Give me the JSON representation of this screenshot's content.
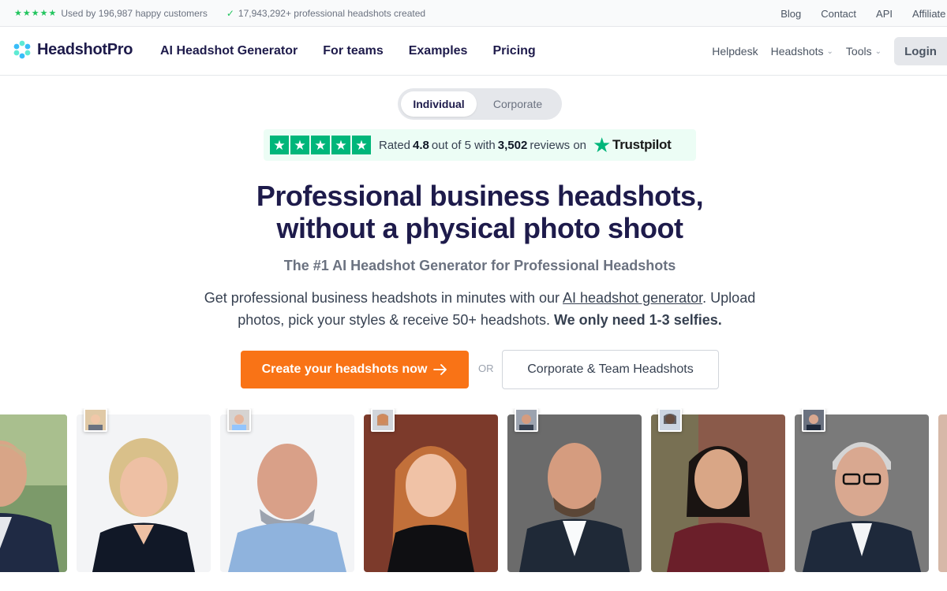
{
  "topbar": {
    "stars_icon": "five-green-stars",
    "customers_text": "Used by 196,987 happy customers",
    "headshots_text": "17,943,292+ professional headshots created",
    "links": [
      "Blog",
      "Contact",
      "API",
      "Affiliate"
    ]
  },
  "nav": {
    "logo_text": "HeadshotPro",
    "links": [
      "AI Headshot Generator",
      "For teams",
      "Examples",
      "Pricing"
    ],
    "right_links": [
      "Helpdesk",
      "Headshots",
      "Tools"
    ],
    "login_label": "Login"
  },
  "toggle": {
    "options": [
      "Individual",
      "Corporate"
    ],
    "selected": "Individual"
  },
  "trustpilot": {
    "rated_prefix": "Rated",
    "rating": "4.8",
    "out_of": "out of 5 with",
    "count": "3,502",
    "suffix": "reviews on",
    "brand": "Trustpilot"
  },
  "hero": {
    "headline_line1": "Professional business headshots,",
    "headline_line2": "without a physical photo shoot",
    "subheadline": "The #1 AI Headshot Generator for Professional Headshots",
    "desc_part1": "Get professional business headshots in minutes with our ",
    "desc_link": "AI headshot generator",
    "desc_part2": ". Upload photos, pick your styles & receive 50+ headshots. ",
    "desc_bold": "We only need 1-3 selfies.",
    "cta_primary": "Create your headshots now",
    "or_label": "OR",
    "cta_secondary": "Corporate & Team Headshots"
  },
  "colors": {
    "brand_dark": "#1e1b4b",
    "accent_orange": "#f97316",
    "trustpilot_green": "#00b67a"
  }
}
